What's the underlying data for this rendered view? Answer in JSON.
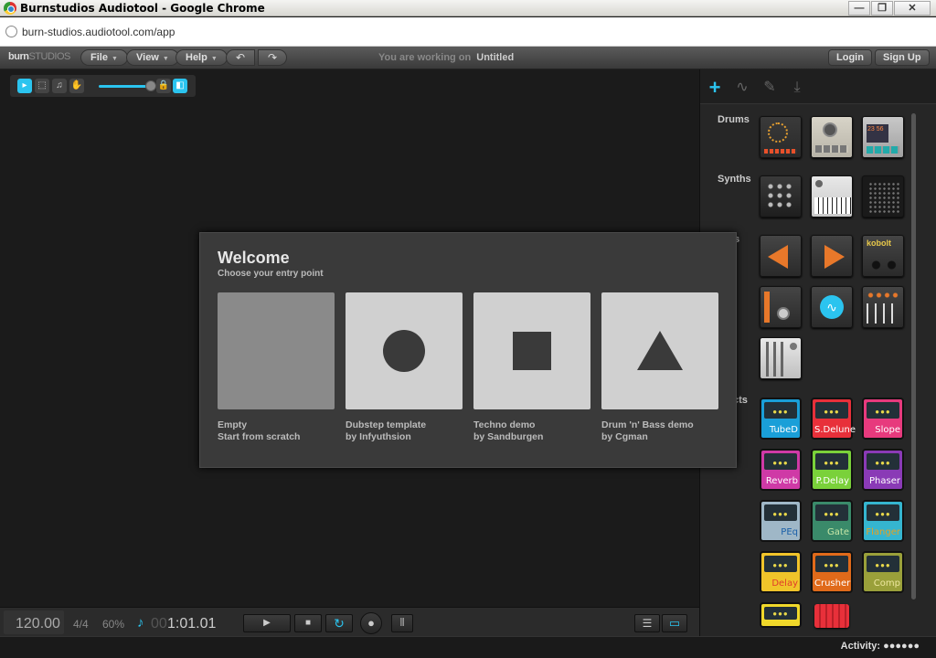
{
  "window": {
    "title": "Burnstudios Audiotool - Google Chrome",
    "url": "burn-studios.audiotool.com/app"
  },
  "appbar": {
    "logo_a": "burn",
    "logo_b": "STUDIOS",
    "menus": [
      "File",
      "View",
      "Help"
    ],
    "working_label": "You are working on",
    "project_name": "Untitled",
    "login": "Login",
    "signup": "Sign Up"
  },
  "welcome": {
    "title": "Welcome",
    "subtitle": "Choose your entry point",
    "options": [
      {
        "name": "Empty",
        "author": "Start from scratch"
      },
      {
        "name": "Dubstep template",
        "author": "by Infyuthsion"
      },
      {
        "name": "Techno demo",
        "author": "by Sandburgen"
      },
      {
        "name": "Drum 'n' Bass demo",
        "author": "by Cgman"
      }
    ]
  },
  "panel": {
    "categories": [
      "Drums",
      "Synths",
      "s",
      "cts"
    ],
    "synth_logo": "kobolt",
    "drum_display": "23 56",
    "pedals": [
      {
        "label": "TubeD",
        "color": "#1a9fd8",
        "text": "#ffffff"
      },
      {
        "label": "S.Delune",
        "color": "#e8303a",
        "text": "#ffffff"
      },
      {
        "label": "Slope",
        "color": "#e73a7d",
        "text": "#ffffff"
      },
      {
        "label": "Reverb",
        "color": "#cf3aa6",
        "text": "#ffffff"
      },
      {
        "label": "P.Delay",
        "color": "#7ad13a",
        "text": "#ffffff"
      },
      {
        "label": "Phaser",
        "color": "#8a3ab6",
        "text": "#ffffff"
      },
      {
        "label": "PEq",
        "color": "#9fb7c7",
        "text": "#1a5fa8"
      },
      {
        "label": "Gate",
        "color": "#3a8a6a",
        "text": "#c8e8a8"
      },
      {
        "label": "Flanger",
        "color": "#35b5cf",
        "text": "#e8a020"
      },
      {
        "label": "Delay",
        "color": "#f0c42a",
        "text": "#e03a2a"
      },
      {
        "label": "Crusher",
        "color": "#e06a1a",
        "text": "#ffffff"
      },
      {
        "label": "Comp",
        "color": "#9aa03a",
        "text": "#eee8a0"
      }
    ]
  },
  "transport": {
    "bpm": "120.00",
    "signature": "4/4",
    "percent": "60%",
    "pos_dim": "00",
    "pos": "1:01.01"
  },
  "status": {
    "activity": "Activity: ●●●●●●"
  },
  "colors": {
    "accent": "#2bc4ef"
  }
}
